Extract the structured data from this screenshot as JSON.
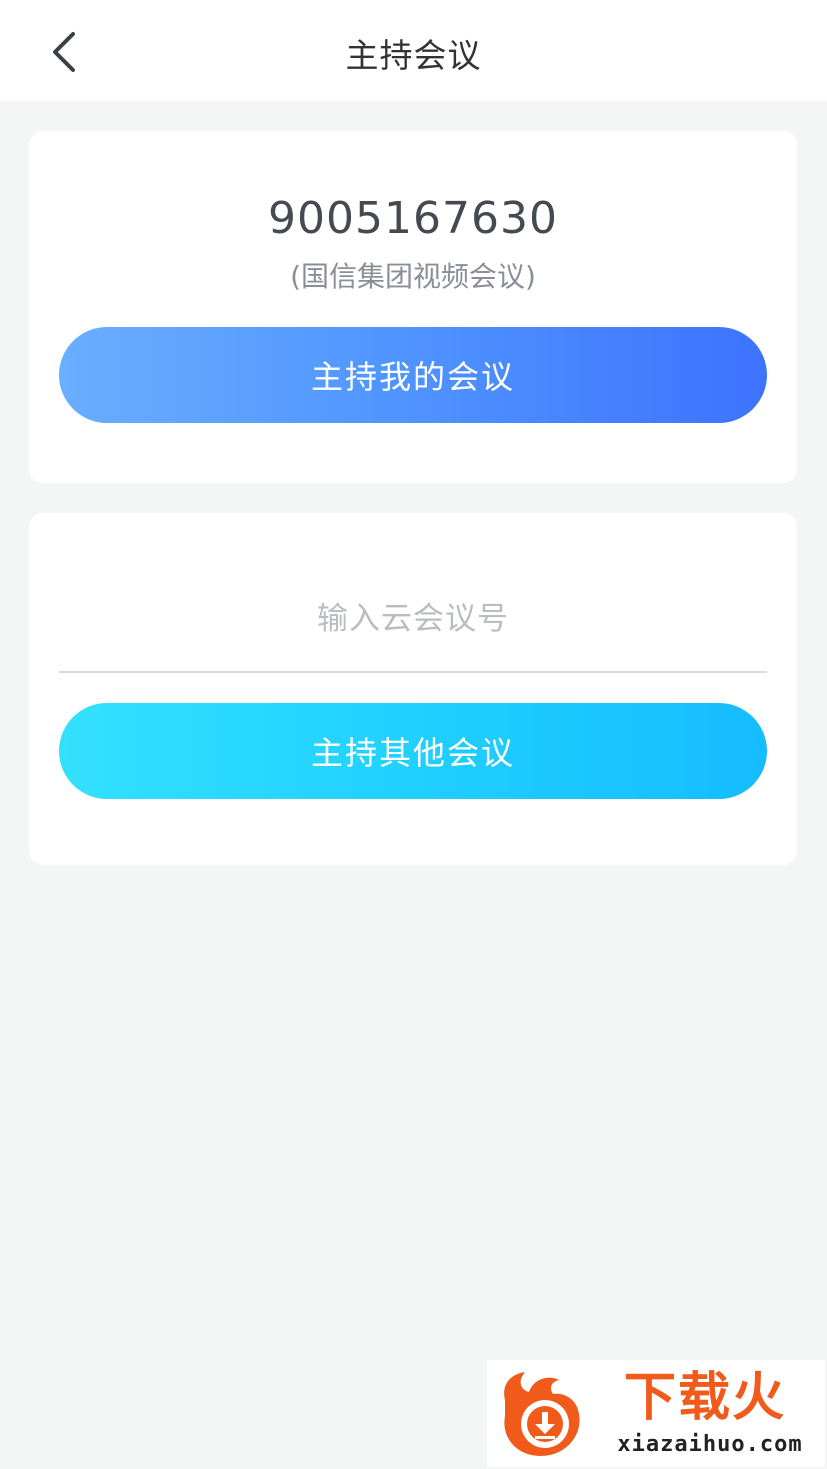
{
  "header": {
    "title": "主持会议",
    "back_icon": "chevron-left-icon"
  },
  "my_meeting": {
    "number": "9005167630",
    "name": "(国信集团视频会议)",
    "button_label": "主持我的会议",
    "button_colors": [
      "#6aaeff",
      "#3d73ff"
    ]
  },
  "other_meeting": {
    "input_value": "",
    "input_placeholder": "输入云会议号",
    "button_label": "主持其他会议",
    "button_colors": [
      "#33e1fe",
      "#15bcff"
    ]
  },
  "watermark": {
    "brand": "下载火",
    "url": "xiazaihuo.com",
    "accent": "#f05a1a"
  }
}
